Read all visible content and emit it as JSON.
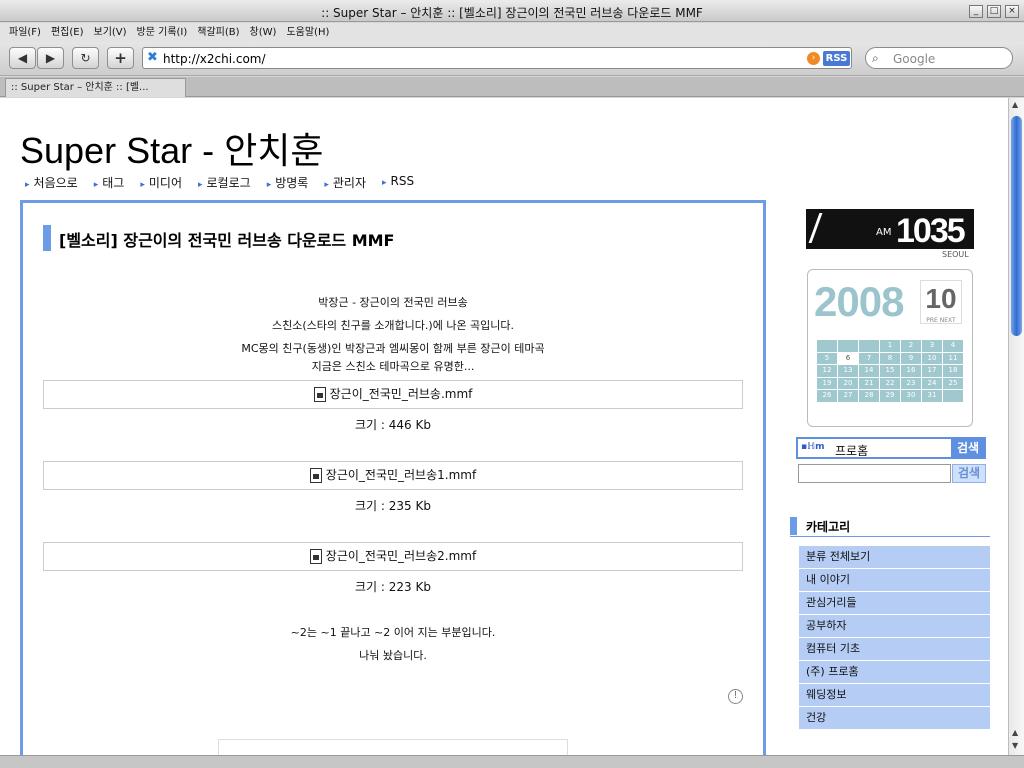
{
  "window": {
    "title": ":: Super Star – 안치훈 :: [벨소리] 장근이의 전국민 러브송 다운로드 MMF"
  },
  "menubar": {
    "items": [
      "파일(F)",
      "편집(E)",
      "보기(V)",
      "방문 기록(I)",
      "책갈피(B)",
      "창(W)",
      "도움말(H)"
    ]
  },
  "toolbar": {
    "url": "http://x2chi.com/",
    "rss_label": "RSS",
    "search_placeholder": "Google"
  },
  "tabs": [
    {
      "label": ":: Super Star – 안치훈 :: [벨..."
    }
  ],
  "blog": {
    "title": "Super Star - 안치훈",
    "nav": [
      "처음으로",
      "태그",
      "미디어",
      "로컬로그",
      "방명록",
      "관리자",
      "RSS"
    ]
  },
  "post": {
    "title": "[벨소리] 장근이의 전국민 러브송 다운로드 MMF",
    "intro": [
      "박장근 - 장근이의 전국민 러브송",
      "스친소(스타의 친구를 소개합니다.)에 나온 곡입니다.",
      "MC몽의 친구(동생)인 박장근과 엠씨몽이 함께 부른 장근이 테마곡",
      "지금은 스친소 테마곡으로 유명한..."
    ],
    "files": [
      {
        "name": "장근이_전국민_러브송.mmf",
        "size": "크기 : 446 Kb"
      },
      {
        "name": "장근이_전국민_러브송1.mmf",
        "size": "크기 : 235 Kb"
      },
      {
        "name": "장근이_전국민_러브송2.mmf",
        "size": "크기 : 223 Kb"
      }
    ],
    "outro": [
      "~2는 ~1 끝나고 ~2 이어 지는 부분입니다.",
      "나눠 놨습니다."
    ]
  },
  "sidebar": {
    "clock": {
      "ampm": "AM",
      "time": "1035",
      "city": "SEOUL"
    },
    "calendar": {
      "year": "2008",
      "month": "10",
      "prev": "PRE",
      "next": "NEXT",
      "days": [
        "",
        "",
        "",
        "1",
        "2",
        "3",
        "4",
        "5",
        "6",
        "7",
        "8",
        "9",
        "10",
        "11",
        "12",
        "13",
        "14",
        "15",
        "16",
        "17",
        "18",
        "19",
        "20",
        "21",
        "22",
        "23",
        "24",
        "25",
        "26",
        "27",
        "28",
        "29",
        "30",
        "31",
        ""
      ],
      "today": "6"
    },
    "search1": {
      "value": "프로홈",
      "button": "검색"
    },
    "search2": {
      "button": "검색"
    },
    "categories": {
      "heading": "카테고리",
      "items": [
        "분류 전체보기",
        "내 이야기",
        "관심거리들",
        "공부하자",
        "컴퓨터 기초",
        "(주) 프로홈",
        "웨딩정보",
        "건강"
      ]
    }
  }
}
